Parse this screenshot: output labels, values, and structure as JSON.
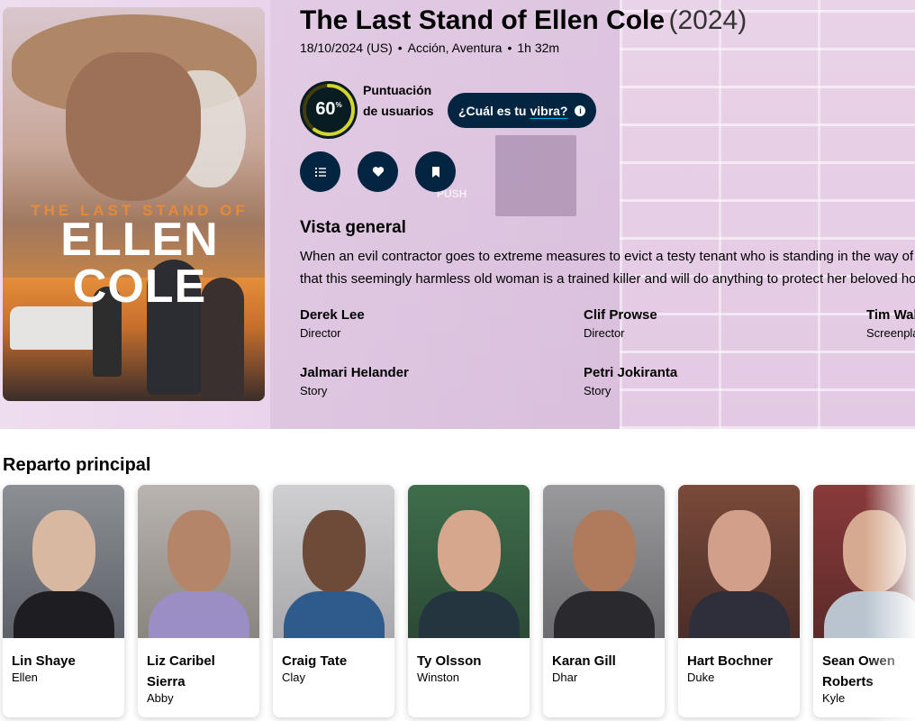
{
  "movie": {
    "title": "The Last Stand of Ellen Cole",
    "year": "(2024)",
    "release": "18/10/2024 (US)",
    "genres": "Acción, Aventura",
    "runtime": "1h 32m"
  },
  "poster": {
    "title_top": "THE LAST STAND OF",
    "title_main": "ELLEN COLE"
  },
  "score": {
    "value": "60",
    "percent_sign": "%",
    "fraction": 0.6,
    "ring_color": "#d2d531",
    "track_color": "#423d0f",
    "label": "Puntuación de usuarios"
  },
  "vibe": {
    "prefix": "¿Cuál es tu",
    "link": "vibra?",
    "info_icon": "info-icon",
    "info_glyph": "i"
  },
  "actions": [
    {
      "name": "add-to-list-button",
      "icon": "list-icon"
    },
    {
      "name": "favorite-button",
      "icon": "heart-icon"
    },
    {
      "name": "watchlist-button",
      "icon": "bookmark-icon"
    }
  ],
  "overview": {
    "heading": "Vista general",
    "line1": "When an evil contractor goes to extreme measures to evict a testy tenant who is standing in the way of his",
    "line2": "that this seemingly harmless old woman is a trained killer and will do anything to protect her beloved hom"
  },
  "crew": [
    {
      "name": "Derek Lee",
      "role": "Director"
    },
    {
      "name": "Clif Prowse",
      "role": "Director"
    },
    {
      "name": "Tim Wal",
      "role": "Screenpla"
    },
    {
      "name": "Jalmari Helander",
      "role": "Story"
    },
    {
      "name": "Petri Jokiranta",
      "role": "Story"
    }
  ],
  "backdrop": {
    "sign_text": "PUSH"
  },
  "cast": {
    "heading": "Reparto principal",
    "members": [
      {
        "name": "Lin Shaye",
        "character": "Ellen"
      },
      {
        "name": "Liz Caribel Sierra",
        "character": "Abby"
      },
      {
        "name": "Craig Tate",
        "character": "Clay"
      },
      {
        "name": "Ty Olsson",
        "character": "Winston"
      },
      {
        "name": "Karan Gill",
        "character": "Dhar"
      },
      {
        "name": "Hart Bochner",
        "character": "Duke"
      },
      {
        "name": "Sean Owen Roberts",
        "character": "Kyle"
      }
    ]
  },
  "colors": {
    "navy": "#032541",
    "dark_circle": "#081c22",
    "accent": "#01b4e4"
  }
}
